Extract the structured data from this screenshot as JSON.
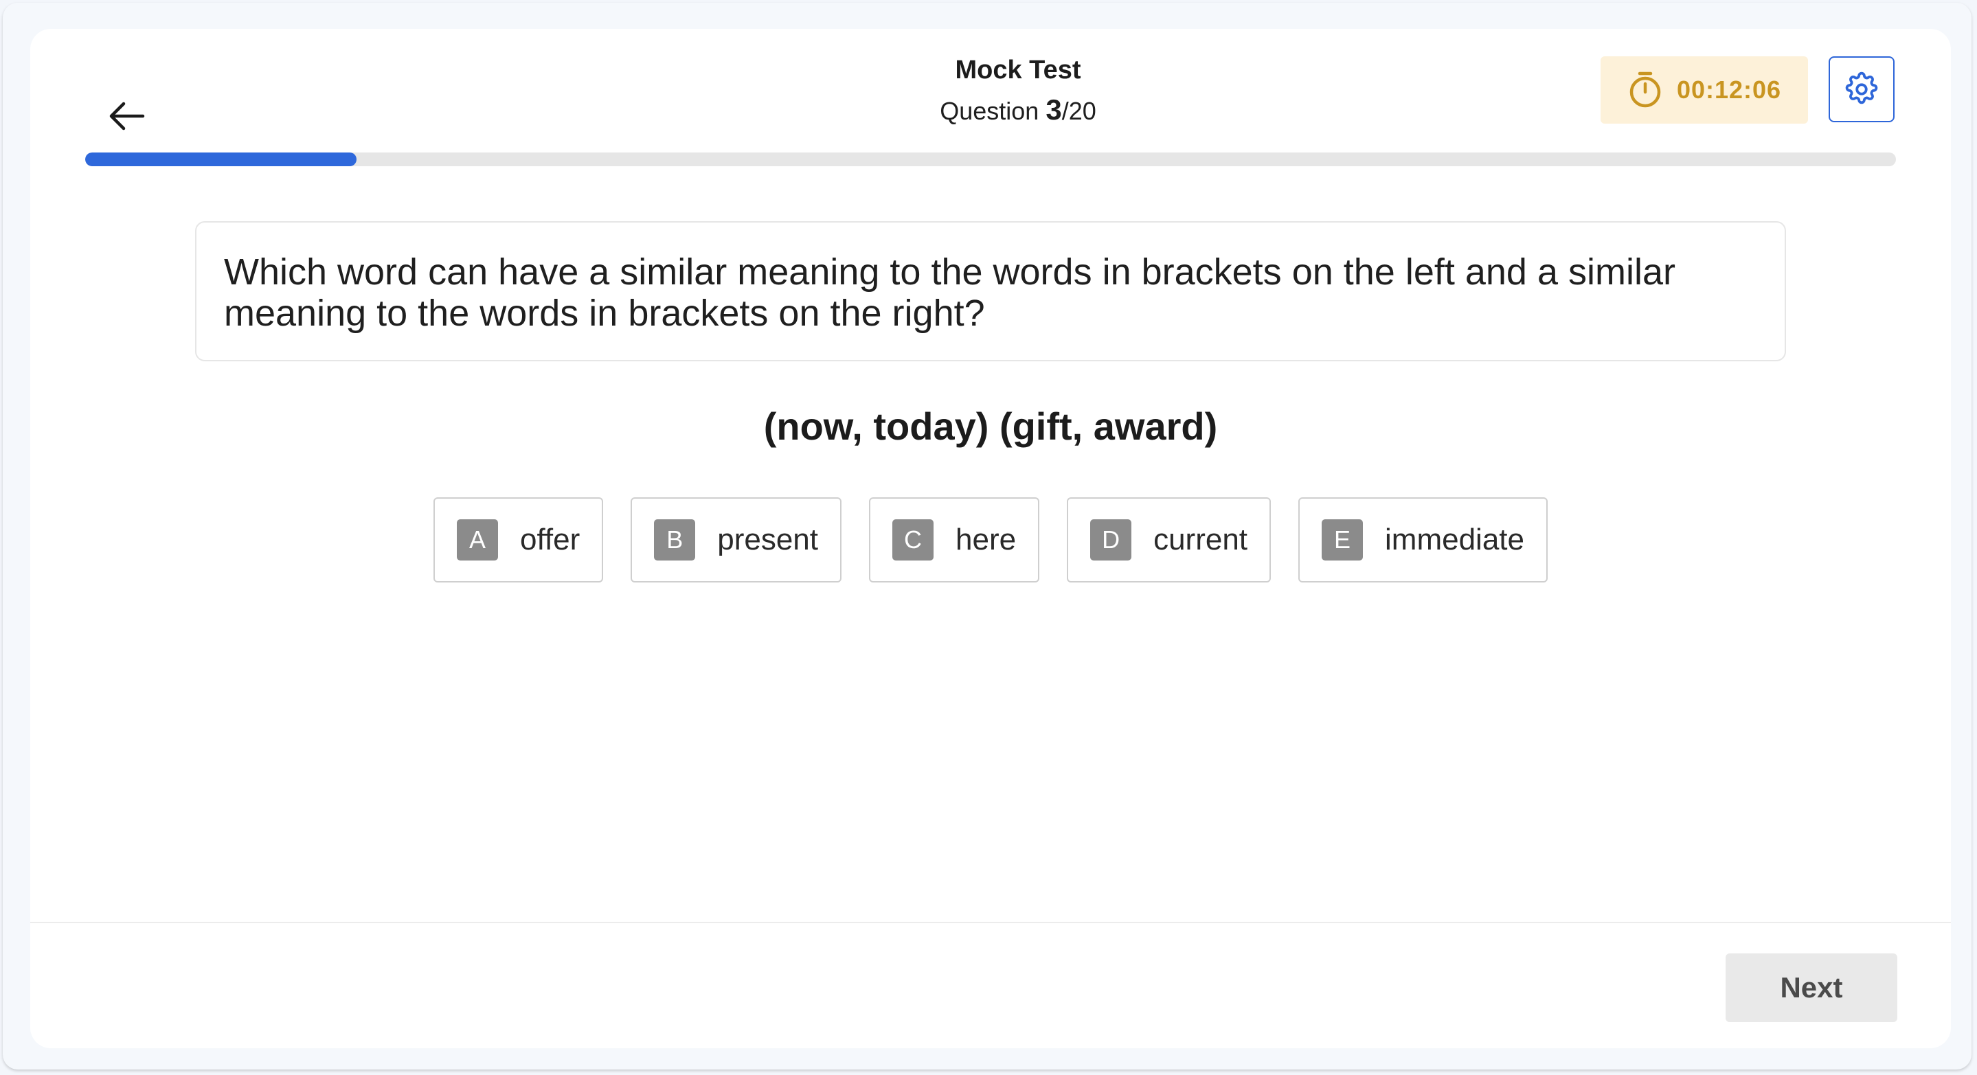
{
  "header": {
    "back_icon": "arrow-left-icon",
    "title": "Mock Test",
    "question_label": "Question",
    "current_question": "3",
    "total_questions": "/20",
    "timer": "00:12:06",
    "timer_icon": "stopwatch-icon",
    "settings_icon": "gear-icon"
  },
  "progress": {
    "fraction": 0.15
  },
  "question": {
    "text": "Which word can have a similar meaning to the words in brackets on the left and a similar meaning to the words in brackets on the right?",
    "prompt": "(now, today) (gift, award)"
  },
  "options": [
    {
      "letter": "A",
      "text": "offer"
    },
    {
      "letter": "B",
      "text": "present"
    },
    {
      "letter": "C",
      "text": "here"
    },
    {
      "letter": "D",
      "text": "current"
    },
    {
      "letter": "E",
      "text": "immediate"
    }
  ],
  "footer": {
    "next_label": "Next"
  },
  "colors": {
    "accent": "#2e68db",
    "timer_bg": "#fdf1d9",
    "timer_text": "#c99521",
    "option_badge": "#8b8b8b"
  }
}
